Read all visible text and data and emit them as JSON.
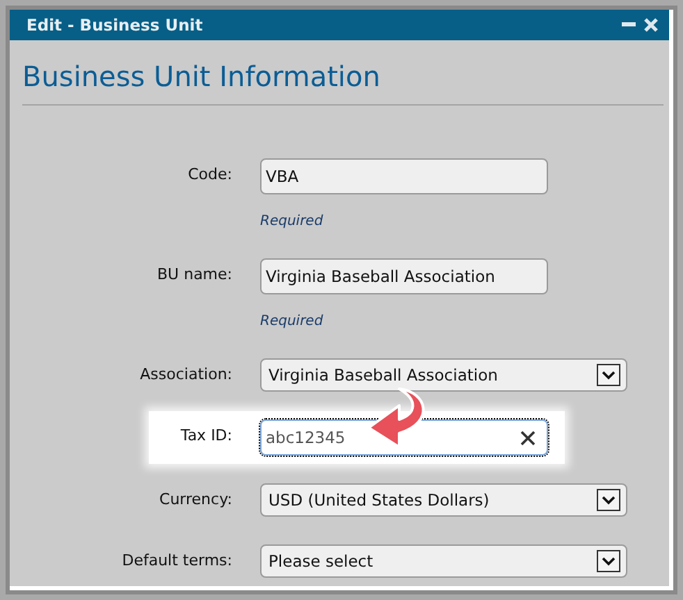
{
  "window": {
    "title": "Edit - Business Unit"
  },
  "heading": "Business Unit Information",
  "fields": [
    {
      "kind": "text",
      "label": "Code:",
      "value": "VBA",
      "note": "Required",
      "highlighted": false,
      "clearable": false
    },
    {
      "kind": "text",
      "label": "BU name:",
      "value": "Virginia Baseball Association",
      "note": "Required",
      "highlighted": false,
      "clearable": false
    },
    {
      "kind": "select",
      "label": "Association:",
      "value": "Virginia Baseball Association",
      "highlighted": false
    },
    {
      "kind": "text",
      "label": "Tax ID:",
      "value": "abc12345",
      "highlighted": true,
      "clearable": true
    },
    {
      "kind": "select",
      "label": "Currency:",
      "value": "USD (United States Dollars)",
      "highlighted": false
    },
    {
      "kind": "select",
      "label": "Default terms:",
      "value": "Please select",
      "highlighted": false
    }
  ]
}
